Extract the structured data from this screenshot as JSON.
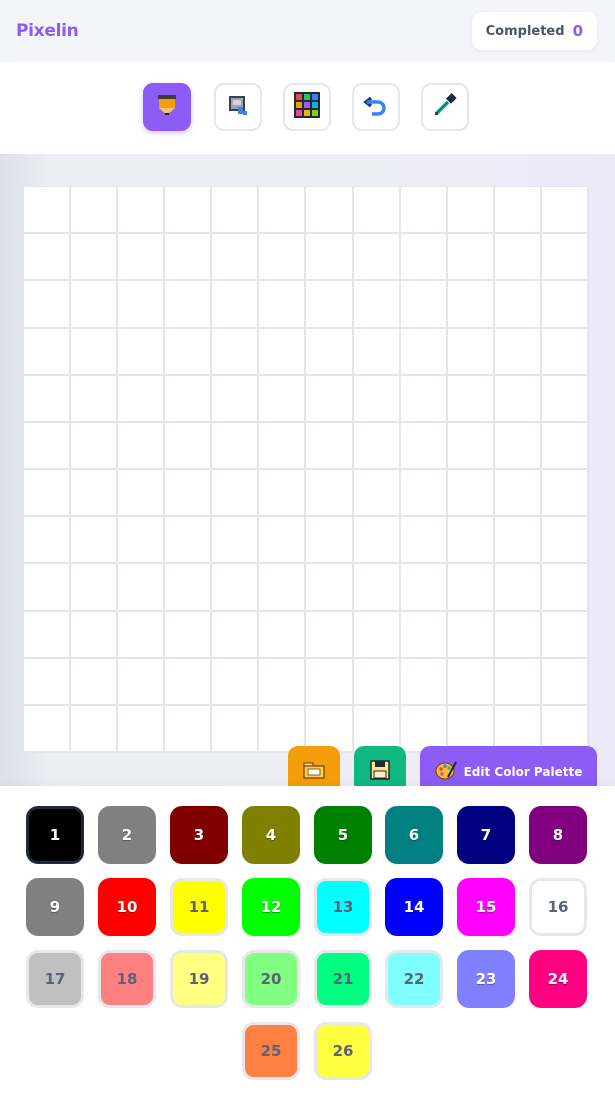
{
  "app": {
    "name": "Pixelin"
  },
  "header": {
    "completed_label": "Completed",
    "completed_count": "0"
  },
  "toolbar": {
    "tools": [
      {
        "name": "pencil-tool",
        "icon": "pencil-icon",
        "active": true
      },
      {
        "name": "fill-bucket-tool",
        "icon": "paint-bucket-icon",
        "active": false
      },
      {
        "name": "color-grid-tool",
        "icon": "color-grid-icon",
        "active": false
      },
      {
        "name": "undo-tool",
        "icon": "undo-icon",
        "active": false
      },
      {
        "name": "eyedropper-tool",
        "icon": "eyedropper-icon",
        "active": false
      }
    ]
  },
  "canvas": {
    "rows": 12,
    "cols": 12
  },
  "actions": {
    "open_icon": "folder-icon",
    "save_icon": "floppy-disk-icon",
    "palette_label": "Edit Color Palette",
    "palette_icon": "palette-icon"
  },
  "palette": {
    "selected": "1",
    "colors": [
      {
        "label": "1",
        "hex": "#000000",
        "light": false
      },
      {
        "label": "2",
        "hex": "#808080",
        "light": false
      },
      {
        "label": "3",
        "hex": "#800000",
        "light": false
      },
      {
        "label": "4",
        "hex": "#808000",
        "light": false
      },
      {
        "label": "5",
        "hex": "#008000",
        "light": false
      },
      {
        "label": "6",
        "hex": "#008080",
        "light": false
      },
      {
        "label": "7",
        "hex": "#000080",
        "light": false
      },
      {
        "label": "8",
        "hex": "#800080",
        "light": false
      },
      {
        "label": "9",
        "hex": "#808080",
        "light": false
      },
      {
        "label": "10",
        "hex": "#ff0000",
        "light": false
      },
      {
        "label": "11",
        "hex": "#ffff00",
        "light": true
      },
      {
        "label": "12",
        "hex": "#00ff00",
        "light": false
      },
      {
        "label": "13",
        "hex": "#00ffff",
        "light": true
      },
      {
        "label": "14",
        "hex": "#0000ff",
        "light": false
      },
      {
        "label": "15",
        "hex": "#ff00ff",
        "light": false
      },
      {
        "label": "16",
        "hex": "#ffffff",
        "light": true
      },
      {
        "label": "17",
        "hex": "#c0c0c0",
        "light": true
      },
      {
        "label": "18",
        "hex": "#ff8080",
        "light": true
      },
      {
        "label": "19",
        "hex": "#ffff80",
        "light": true
      },
      {
        "label": "20",
        "hex": "#80ff80",
        "light": true
      },
      {
        "label": "21",
        "hex": "#00ff80",
        "light": true
      },
      {
        "label": "22",
        "hex": "#80ffff",
        "light": true
      },
      {
        "label": "23",
        "hex": "#8080ff",
        "light": false
      },
      {
        "label": "24",
        "hex": "#ff0080",
        "light": false
      },
      {
        "label": "25",
        "hex": "#ff8040",
        "light": true
      },
      {
        "label": "26",
        "hex": "#ffff40",
        "light": true
      }
    ]
  }
}
